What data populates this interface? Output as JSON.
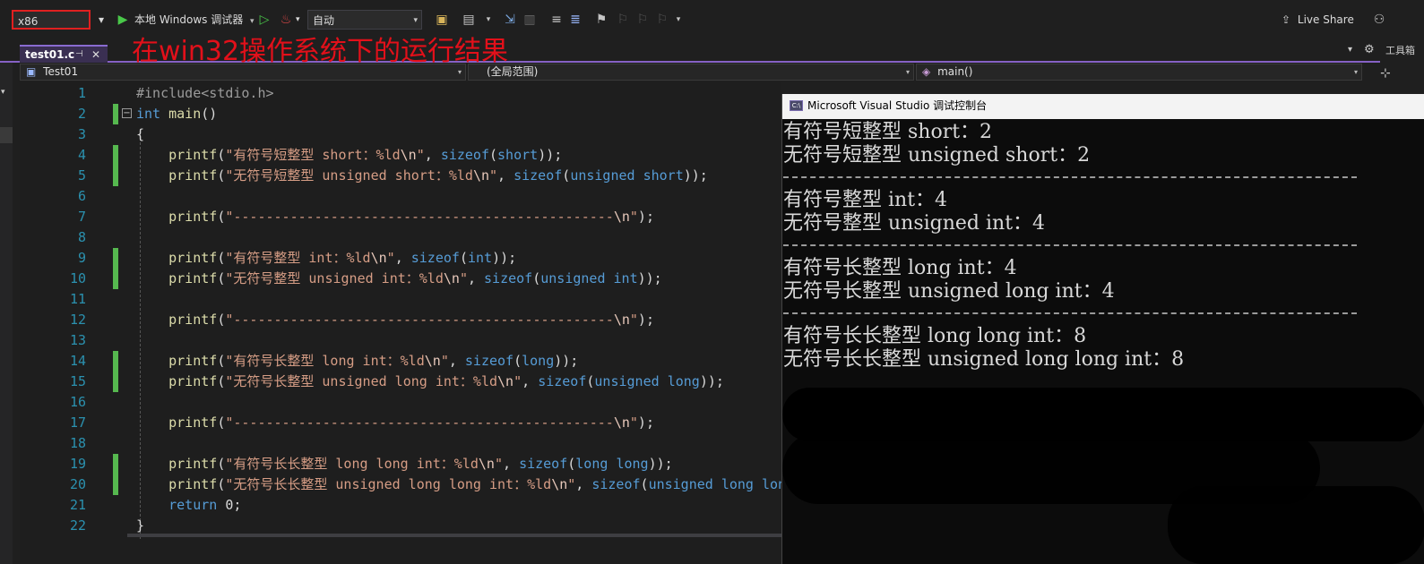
{
  "toolbar": {
    "platform": "x86",
    "debug_target": "本地 Windows 调试器",
    "config": "自动",
    "live_share": "Live Share"
  },
  "tabs": {
    "active_file": "test01.c"
  },
  "annotation": "在win32操作系统下的运行结果",
  "navbar": {
    "project": "Test01",
    "scope": "(全局范围)",
    "member": "main()"
  },
  "editor": {
    "line_numbers": [
      "1",
      "2",
      "3",
      "4",
      "5",
      "6",
      "7",
      "8",
      "9",
      "10",
      "11",
      "12",
      "13",
      "14",
      "15",
      "16",
      "17",
      "18",
      "19",
      "20",
      "21",
      "22"
    ],
    "lines": [
      "#include<stdio.h>",
      "int main()",
      "{",
      "    printf(\"有符号短整型 short：%ld\\n\", sizeof(short));",
      "    printf(\"无符号短整型 unsigned short：%ld\\n\", sizeof(unsigned short));",
      "",
      "    printf(\"-----------------------------------------------\\n\");",
      "",
      "    printf(\"有符号整型 int：%ld\\n\", sizeof(int));",
      "    printf(\"无符号整型 unsigned int：%ld\\n\", sizeof(unsigned int));",
      "",
      "    printf(\"-----------------------------------------------\\n\");",
      "",
      "    printf(\"有符号长整型 long int：%ld\\n\", sizeof(long));",
      "    printf(\"无符号长整型 unsigned long int：%ld\\n\", sizeof(unsigned long));",
      "",
      "    printf(\"-----------------------------------------------\\n\");",
      "",
      "    printf(\"有符号长长整型 long long int：%ld\\n\", sizeof(long long));",
      "    printf(\"无符号长长整型 unsigned long long int：%ld\\n\", sizeof(unsigned long long));",
      "    return 0;",
      "}"
    ]
  },
  "console": {
    "title": "Microsoft Visual Studio 调试控制台",
    "output": [
      "有符号短整型 short：2",
      "无符号短整型 unsigned short：2",
      "---",
      "有符号整型 int：4",
      "无符号整型 unsigned int：4",
      "---",
      "有符号长整型 long int：4",
      "无符号长整型 unsigned long int：4",
      "---",
      "有符号长长整型 long long int：8",
      "无符号长长整型 unsigned long long int：8"
    ]
  },
  "colors": {
    "annotation_red": "#e2101a",
    "accent_purple": "#8661c5",
    "change_green": "#56b84f",
    "line_number_teal": "#2b91af",
    "keyword_blue": "#569cd6",
    "string_salmon": "#d69d85"
  }
}
